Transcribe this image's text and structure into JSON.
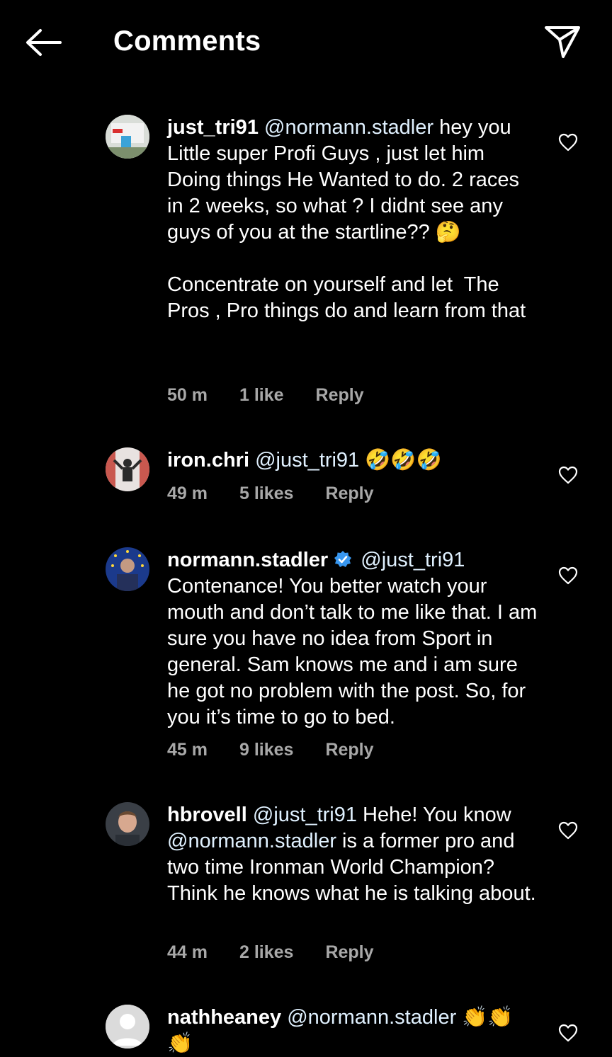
{
  "header": {
    "title": "Comments",
    "back_icon": "arrow-left-icon",
    "share_icon": "paper-plane-icon"
  },
  "comments": [
    {
      "username": "just_tri91",
      "mention": "@normann.stadler",
      "text_after_mention": " hey you Little super Profi Guys , just let him Doing things He Wanted to do. 2 races in 2 weeks, so what ? I didnt see any guys of you at the startline?? 🤔\n\nConcentrate on yourself and let  The Pros , Pro things do and learn from that",
      "time": "50 m",
      "likes": "1 like",
      "reply": "Reply"
    },
    {
      "username": "iron.chri",
      "mention": "@just_tri91",
      "text_after_mention": " 🤣🤣🤣",
      "time": "49 m",
      "likes": "5 likes",
      "reply": "Reply"
    },
    {
      "username": "normann.stadler",
      "verified": true,
      "mention": "@just_tri91",
      "text_after_mention": "\nContenance! You better watch your mouth and don’t talk to me like that. I am sure you have no idea from Sport in general. Sam knows me and i am sure he got no problem with the post. So, for you it’s time to go to bed.",
      "time": "45 m",
      "likes": "9 likes",
      "reply": "Reply"
    },
    {
      "username": "hbrovell",
      "mention": "@just_tri91",
      "text_mid": " Hehe! You know ",
      "mention2": "@normann.stadler",
      "text_after_mention": " is a former pro and two time Ironman World Champion? Think he knows what he is talking about.",
      "time": "44 m",
      "likes": "2 likes",
      "reply": "Reply"
    },
    {
      "username": "nathheaney",
      "mention": "@normann.stadler",
      "text_after_mention": " 👏👏\n👏"
    }
  ],
  "colors": {
    "background": "#000000",
    "text": "#ffffff",
    "meta": "#a8a8a8",
    "verified": "#3897f0"
  }
}
